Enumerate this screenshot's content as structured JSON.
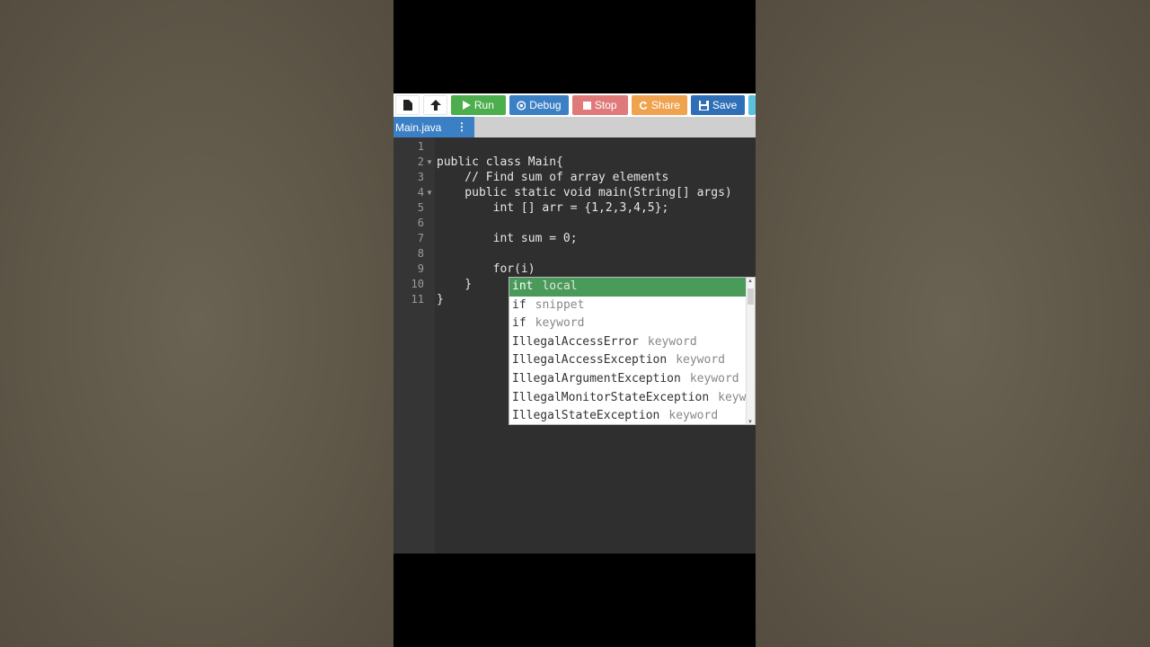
{
  "toolbar": {
    "run_label": "Run",
    "debug_label": "Debug",
    "stop_label": "Stop",
    "share_label": "Share",
    "save_label": "Save"
  },
  "tab": {
    "filename": "Main.java",
    "menu": "⋮"
  },
  "editor": {
    "lines": [
      {
        "n": "1",
        "text": ""
      },
      {
        "n": "2",
        "text": "public class Main{"
      },
      {
        "n": "3",
        "text": "    // Find sum of array elements"
      },
      {
        "n": "4",
        "text": "    public static void main(String[] args)"
      },
      {
        "n": "5",
        "text": "        int [] arr = {1,2,3,4,5};"
      },
      {
        "n": "6",
        "text": ""
      },
      {
        "n": "7",
        "text": "        int sum = 0;"
      },
      {
        "n": "8",
        "text": ""
      },
      {
        "n": "9",
        "text": "        for(i)"
      },
      {
        "n": "10",
        "text": "    }"
      },
      {
        "n": "11",
        "text": "}"
      }
    ]
  },
  "autocomplete": {
    "items": [
      {
        "label": "int",
        "meta": "local"
      },
      {
        "label": "if",
        "meta": "snippet"
      },
      {
        "label": "if",
        "meta": "keyword"
      },
      {
        "label": "IllegalAccessError",
        "meta": "keyword"
      },
      {
        "label": "IllegalAccessException",
        "meta": "keyword"
      },
      {
        "label": "IllegalArgumentException",
        "meta": "keyword"
      },
      {
        "label": "IllegalMonitorStateException",
        "meta": "keyword"
      },
      {
        "label": "IllegalStateException",
        "meta": "keyword"
      }
    ]
  }
}
